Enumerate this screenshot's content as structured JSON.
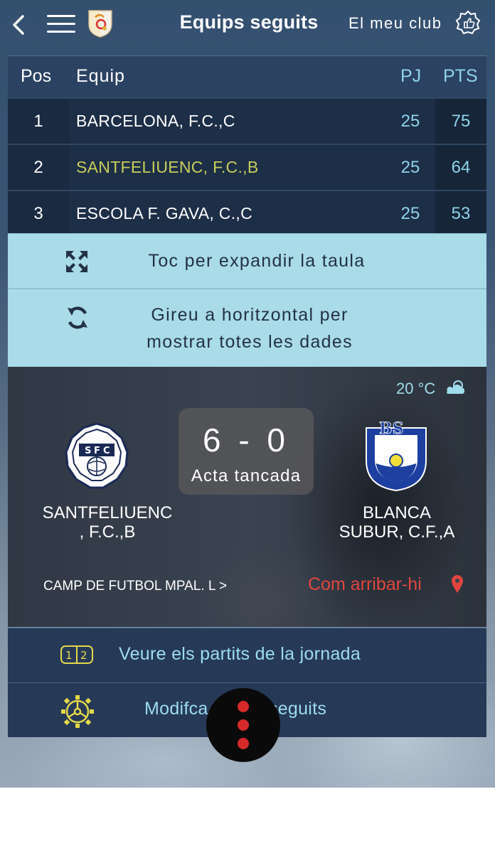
{
  "header": {
    "title": "Equips seguits",
    "my_club_label": "El meu club"
  },
  "standings": {
    "columns": {
      "pos": "Pos",
      "team": "Equip",
      "pj": "PJ",
      "pts": "PTS"
    },
    "rows": [
      {
        "pos": "1",
        "team": "BARCELONA, F.C.,C",
        "pj": "25",
        "pts": "75",
        "highlight": false
      },
      {
        "pos": "2",
        "team": "SANTFELIUENC, F.C.,B",
        "pj": "25",
        "pts": "64",
        "highlight": true
      },
      {
        "pos": "3",
        "team": "ESCOLA F. GAVA, C.,C",
        "pj": "25",
        "pts": "53",
        "highlight": false
      }
    ]
  },
  "expand_table": {
    "label": "Toc per expandir la taula"
  },
  "rotate_hint": {
    "line1": "Gireu a horitzontal per",
    "line2": "mostrar totes les dades"
  },
  "match": {
    "temperature": "20 °C",
    "weather_icon": "partly-cloudy-icon",
    "score": "6 - 0",
    "status": "Acta tancada",
    "home_team_line1": "SANTFELIUENC",
    "home_team_line2": ", F.C.,B",
    "home_badge_letters": [
      "S",
      "F",
      "C"
    ],
    "away_team_line1": "BLANCA",
    "away_team_line2": "SUBUR, C.F.,A",
    "away_badge_letters": "BS",
    "venue": "CAMP DE FUTBOL MPAL. L >",
    "directions_label": "Com arribar-hi"
  },
  "links": {
    "round_matches": "Veure els partits de la jornada",
    "modify_followed": "Modifca         s seguits"
  },
  "colors": {
    "accent_cyan": "#9ddcef",
    "highlight_team": "#c7cf5a",
    "directions_red": "#e0463e",
    "fab_dots": "#d62a2a"
  }
}
